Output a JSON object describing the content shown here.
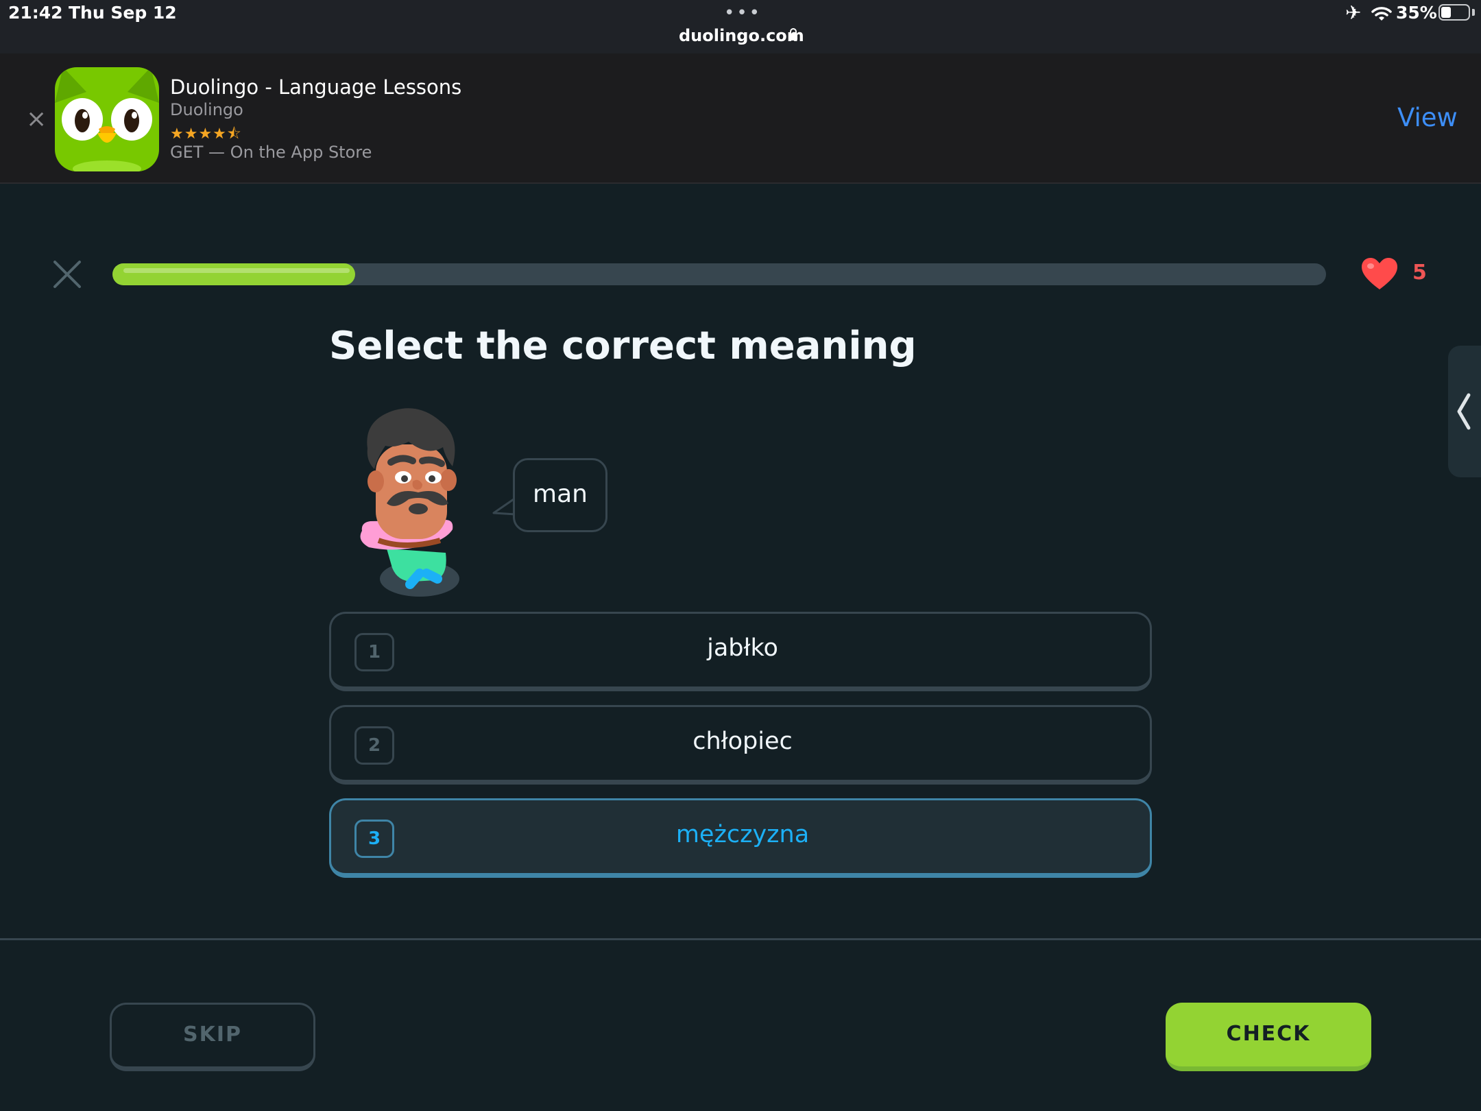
{
  "status_bar": {
    "time": "21:42",
    "date": "Thu Sep 12",
    "more_dots": "•••",
    "url": "duolingo.com",
    "battery_percent": "35%",
    "battery_level": 0.35
  },
  "app_banner": {
    "close_glyph": "×",
    "app_name": "Duolingo - Language Lessons",
    "developer": "Duolingo",
    "rating_stars": "★★★★⯪",
    "rating_value": 4.5,
    "store_text": "GET — On the App Store",
    "view_label": "View"
  },
  "lesson": {
    "progress_fraction": 0.2,
    "hearts": "5",
    "prompt_title": "Select the correct meaning",
    "speech_bubble_word": "man",
    "choices": [
      {
        "number": "1",
        "label": "jabłko",
        "selected": false
      },
      {
        "number": "2",
        "label": "chłopiec",
        "selected": false
      },
      {
        "number": "3",
        "label": "mężczyzna",
        "selected": true
      }
    ],
    "skip_label": "SKIP",
    "check_label": "CHECK"
  },
  "colors": {
    "background": "#131f24",
    "progress_green": "#93d333",
    "selected_blue": "#1cb0f6",
    "heart_red": "#ee5555",
    "banner_link_blue": "#3d8ef7"
  },
  "icons": {
    "lock": "lock-icon",
    "airplane": "airplane-icon",
    "wifi": "wifi-icon",
    "battery": "battery-icon",
    "close": "close-icon",
    "heart": "heart-icon",
    "chevron": "chevron-left-icon",
    "app": "duolingo-owl-icon"
  }
}
